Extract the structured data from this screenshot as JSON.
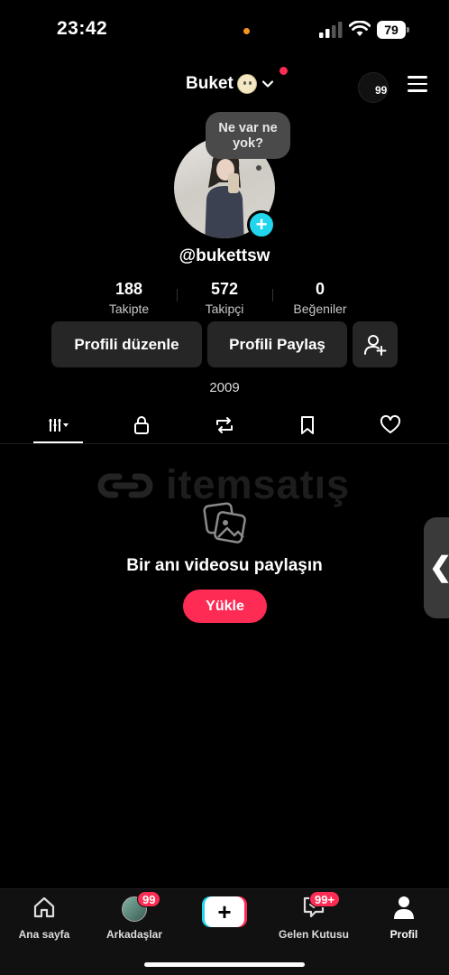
{
  "status_bar": {
    "time": "23:42",
    "battery": "79"
  },
  "header": {
    "account_name": "Buket",
    "story_count": "99"
  },
  "profile": {
    "bubble_text": "Ne var ne yok?",
    "handle": "@bukettsw",
    "bio": "2009",
    "stats": [
      {
        "value": "188",
        "label": "Takipte"
      },
      {
        "value": "572",
        "label": "Takipçi"
      },
      {
        "value": "0",
        "label": "Beğeniler"
      }
    ]
  },
  "actions": {
    "edit_label": "Profili düzenle",
    "share_label": "Profili Paylaş"
  },
  "tabs": [
    "videos-icon",
    "lock-icon",
    "repost-icon",
    "bookmark-icon",
    "heart-icon"
  ],
  "watermark": {
    "text": "itemsatış"
  },
  "empty_state": {
    "title": "Bir anı videosu paylaşın",
    "upload_label": "Yükle"
  },
  "bottom_nav": {
    "home": "Ana sayfa",
    "friends": "Arkadaşlar",
    "friends_badge": "99",
    "inbox": "Gelen Kutusu",
    "inbox_badge": "99+",
    "profile": "Profil"
  },
  "colors": {
    "accent": "#fe2c55",
    "cyan": "#20d5ec",
    "background": "#000000",
    "button": "#262626"
  }
}
